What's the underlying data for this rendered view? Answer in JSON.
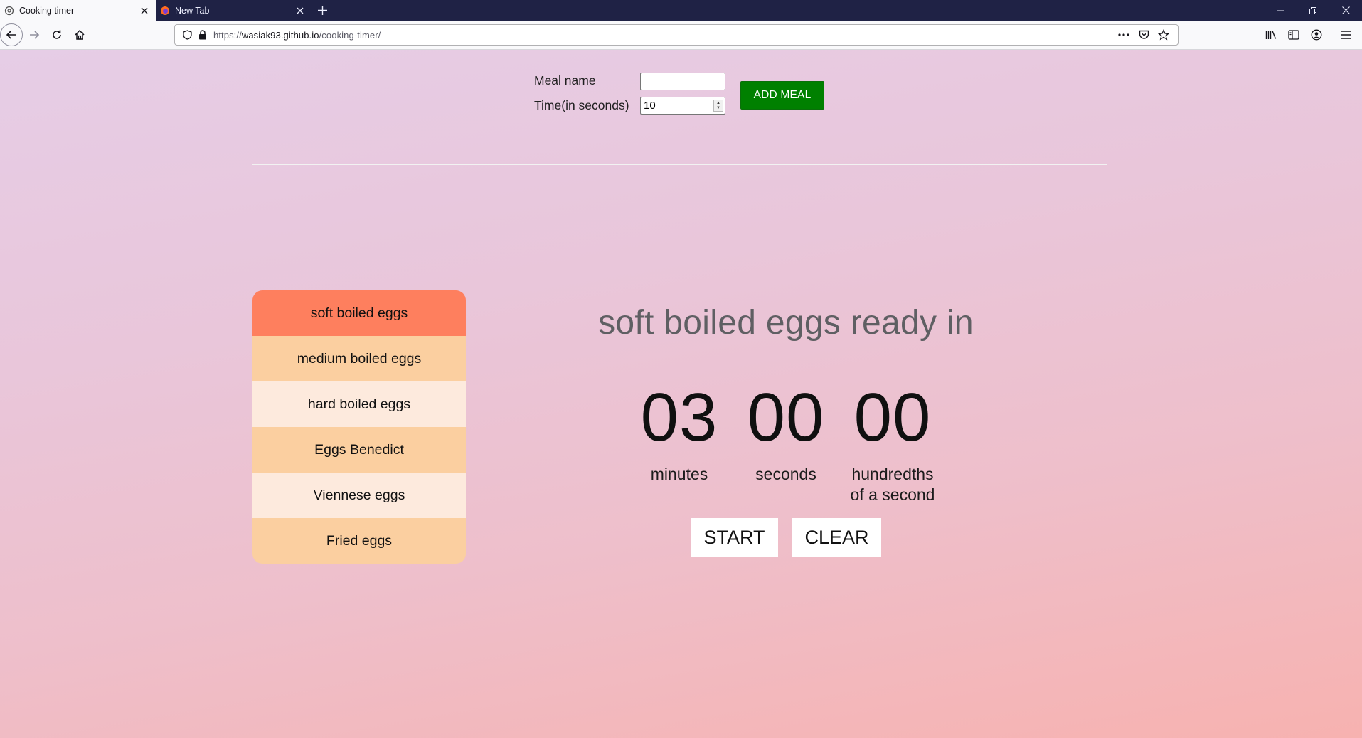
{
  "browser": {
    "tabs": [
      {
        "title": "Cooking timer",
        "active": true,
        "icon": "gear-favicon"
      },
      {
        "title": "New Tab",
        "active": false,
        "icon": "firefox-favicon"
      }
    ],
    "url": {
      "scheme": "https://",
      "domain": "wasiak93.github.io",
      "path": "/cooking-timer/"
    }
  },
  "form": {
    "meal_name_label": "Meal name",
    "meal_name_value": "",
    "time_label": "Time(in seconds)",
    "time_value": "10",
    "add_button": "ADD MEAL"
  },
  "meals": [
    {
      "name": "soft boiled eggs",
      "selected": true
    },
    {
      "name": "medium boiled eggs",
      "selected": false
    },
    {
      "name": "hard boiled eggs",
      "selected": false
    },
    {
      "name": "Eggs Benedict",
      "selected": false
    },
    {
      "name": "Viennese eggs",
      "selected": false
    },
    {
      "name": "Fried eggs",
      "selected": false
    }
  ],
  "timer": {
    "title": "soft boiled eggs ready in",
    "minutes": "03",
    "seconds": "00",
    "hundredths": "00",
    "minutes_label": "minutes",
    "seconds_label": "seconds",
    "hundredths_label_line1": "hundredths",
    "hundredths_label_line2": "of a second",
    "start_button": "START",
    "clear_button": "CLEAR"
  },
  "colors": {
    "selected_meal": "#fe7f5e",
    "meal_odd": "#fbcfa0",
    "meal_even": "#fdeadd",
    "add_button": "#008000"
  }
}
